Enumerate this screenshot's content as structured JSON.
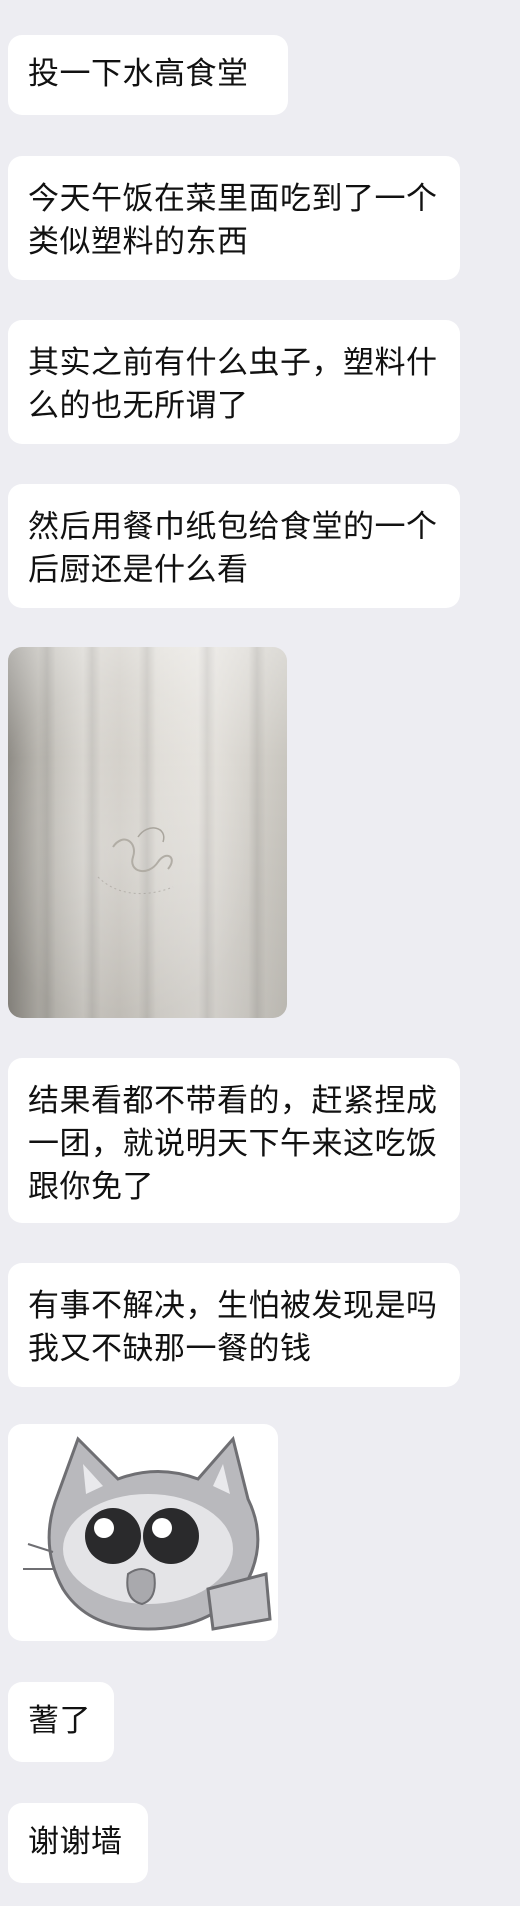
{
  "messages": [
    {
      "text": "投一下水高食堂"
    },
    {
      "text": "今天午饭在菜里面吃到了一个类似塑料的东西"
    },
    {
      "text": "其实之前有什么虫子，塑料什么的也无所谓了"
    },
    {
      "text": "然后用餐巾纸包给食堂的一个后厨还是什么看"
    },
    {
      "text": "结果看都不带看的，赶紧捏成一团，就说明天下午来这吃饭跟你免了"
    },
    {
      "text": "有事不解决，生怕被发现是吗我又不缺那一餐的钱"
    },
    {
      "text": "蓍了"
    },
    {
      "text": "谢谢墙"
    }
  ],
  "photo_icon": "napkin-photo",
  "sticker_icon": "cat-sticker"
}
